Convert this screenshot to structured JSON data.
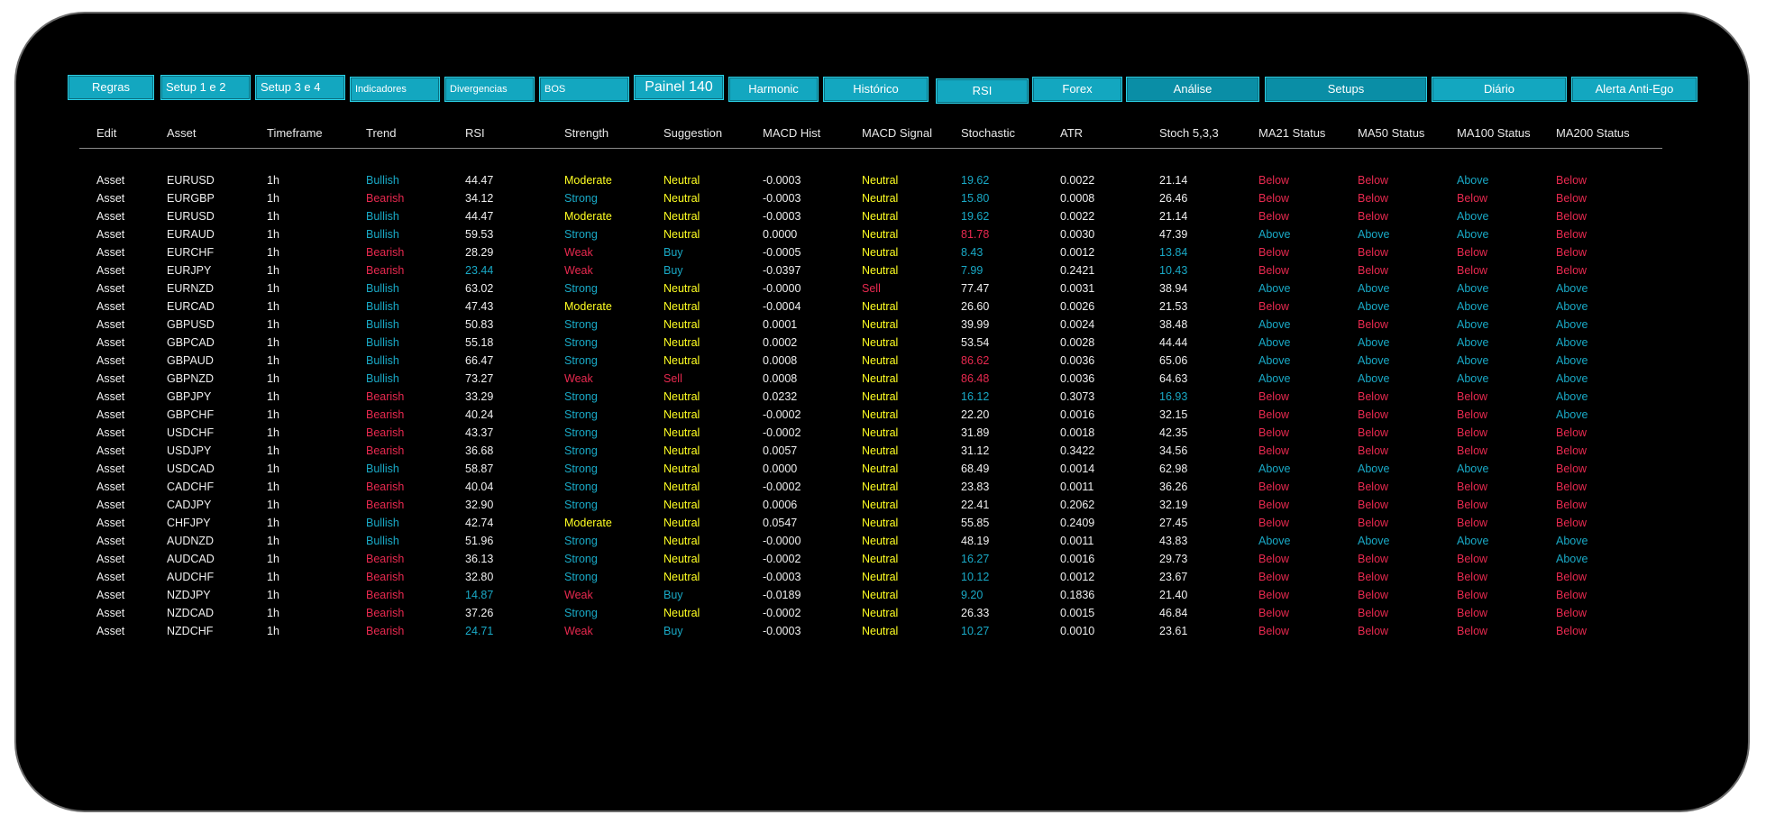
{
  "colors": {
    "cyan": "#19a9c6",
    "red": "#e8294f",
    "yellow": "#ffff22",
    "white": "#f0f0f0",
    "tab": "#13a7c0"
  },
  "tabs": [
    "Regras",
    "Setup 1 e 2",
    "Setup 3 e 4",
    "Indicadores",
    "Divergencias",
    "BOS",
    "Painel 140",
    "Harmonic",
    "Histórico",
    "RSI",
    "Forex",
    "Análise",
    "Setups",
    "Diário",
    "Alerta Anti-Ego"
  ],
  "table": {
    "headers": [
      "Edit",
      "Asset",
      "Timeframe",
      "Trend",
      "RSI",
      "Strength",
      "Suggestion",
      "MACD Hist",
      "MACD Signal",
      "Stochastic",
      "ATR",
      "Stoch 5,3,3",
      "MA21 Status",
      "MA50 Status",
      "MA100 Status",
      "MA200 Status"
    ],
    "rows": [
      [
        "Asset",
        "EURUSD",
        "1h",
        "Bullish",
        "44.47",
        "Moderate",
        "Neutral",
        "-0.0003",
        "Neutral",
        "19.62",
        "0.0022",
        "21.14",
        "Below",
        "Below",
        "Above",
        "Below"
      ],
      [
        "Asset",
        "EURGBP",
        "1h",
        "Bearish",
        "34.12",
        "Strong",
        "Neutral",
        "-0.0003",
        "Neutral",
        "15.80",
        "0.0008",
        "26.46",
        "Below",
        "Below",
        "Below",
        "Below"
      ],
      [
        "Asset",
        "EURUSD",
        "1h",
        "Bullish",
        "44.47",
        "Moderate",
        "Neutral",
        "-0.0003",
        "Neutral",
        "19.62",
        "0.0022",
        "21.14",
        "Below",
        "Below",
        "Above",
        "Below"
      ],
      [
        "Asset",
        "EURAUD",
        "1h",
        "Bullish",
        "59.53",
        "Strong",
        "Neutral",
        "0.0000",
        "Neutral",
        "81.78",
        "0.0030",
        "47.39",
        "Above",
        "Above",
        "Above",
        "Below"
      ],
      [
        "Asset",
        "EURCHF",
        "1h",
        "Bearish",
        "28.29",
        "Weak",
        "Buy",
        "-0.0005",
        "Neutral",
        "8.43",
        "0.0012",
        "13.84",
        "Below",
        "Below",
        "Below",
        "Below"
      ],
      [
        "Asset",
        "EURJPY",
        "1h",
        "Bearish",
        "23.44",
        "Weak",
        "Buy",
        "-0.0397",
        "Neutral",
        "7.99",
        "0.2421",
        "10.43",
        "Below",
        "Below",
        "Below",
        "Below"
      ],
      [
        "Asset",
        "EURNZD",
        "1h",
        "Bullish",
        "63.02",
        "Strong",
        "Neutral",
        "-0.0000",
        "Sell",
        "77.47",
        "0.0031",
        "38.94",
        "Above",
        "Above",
        "Above",
        "Above"
      ],
      [
        "Asset",
        "EURCAD",
        "1h",
        "Bullish",
        "47.43",
        "Moderate",
        "Neutral",
        "-0.0004",
        "Neutral",
        "26.60",
        "0.0026",
        "21.53",
        "Below",
        "Above",
        "Above",
        "Above"
      ],
      [
        "Asset",
        "GBPUSD",
        "1h",
        "Bullish",
        "50.83",
        "Strong",
        "Neutral",
        "0.0001",
        "Neutral",
        "39.99",
        "0.0024",
        "38.48",
        "Above",
        "Below",
        "Above",
        "Above"
      ],
      [
        "Asset",
        "GBPCAD",
        "1h",
        "Bullish",
        "55.18",
        "Strong",
        "Neutral",
        "0.0002",
        "Neutral",
        "53.54",
        "0.0028",
        "44.44",
        "Above",
        "Above",
        "Above",
        "Above"
      ],
      [
        "Asset",
        "GBPAUD",
        "1h",
        "Bullish",
        "66.47",
        "Strong",
        "Neutral",
        "0.0008",
        "Neutral",
        "86.62",
        "0.0036",
        "65.06",
        "Above",
        "Above",
        "Above",
        "Above"
      ],
      [
        "Asset",
        "GBPNZD",
        "1h",
        "Bullish",
        "73.27",
        "Weak",
        "Sell",
        "0.0008",
        "Neutral",
        "86.48",
        "0.0036",
        "64.63",
        "Above",
        "Above",
        "Above",
        "Above"
      ],
      [
        "Asset",
        "GBPJPY",
        "1h",
        "Bearish",
        "33.29",
        "Strong",
        "Neutral",
        "0.0232",
        "Neutral",
        "16.12",
        "0.3073",
        "16.93",
        "Below",
        "Below",
        "Below",
        "Above"
      ],
      [
        "Asset",
        "GBPCHF",
        "1h",
        "Bearish",
        "40.24",
        "Strong",
        "Neutral",
        "-0.0002",
        "Neutral",
        "22.20",
        "0.0016",
        "32.15",
        "Below",
        "Below",
        "Below",
        "Above"
      ],
      [
        "Asset",
        "USDCHF",
        "1h",
        "Bearish",
        "43.37",
        "Strong",
        "Neutral",
        "-0.0002",
        "Neutral",
        "31.89",
        "0.0018",
        "42.35",
        "Below",
        "Below",
        "Below",
        "Below"
      ],
      [
        "Asset",
        "USDJPY",
        "1h",
        "Bearish",
        "36.68",
        "Strong",
        "Neutral",
        "0.0057",
        "Neutral",
        "31.12",
        "0.3422",
        "34.56",
        "Below",
        "Below",
        "Below",
        "Below"
      ],
      [
        "Asset",
        "USDCAD",
        "1h",
        "Bullish",
        "58.87",
        "Strong",
        "Neutral",
        "0.0000",
        "Neutral",
        "68.49",
        "0.0014",
        "62.98",
        "Above",
        "Above",
        "Above",
        "Below"
      ],
      [
        "Asset",
        "CADCHF",
        "1h",
        "Bearish",
        "40.04",
        "Strong",
        "Neutral",
        "-0.0002",
        "Neutral",
        "23.83",
        "0.0011",
        "36.26",
        "Below",
        "Below",
        "Below",
        "Below"
      ],
      [
        "Asset",
        "CADJPY",
        "1h",
        "Bearish",
        "32.90",
        "Strong",
        "Neutral",
        "0.0006",
        "Neutral",
        "22.41",
        "0.2062",
        "32.19",
        "Below",
        "Below",
        "Below",
        "Below"
      ],
      [
        "Asset",
        "CHFJPY",
        "1h",
        "Bullish",
        "42.74",
        "Moderate",
        "Neutral",
        "0.0547",
        "Neutral",
        "55.85",
        "0.2409",
        "27.45",
        "Below",
        "Below",
        "Below",
        "Below"
      ],
      [
        "Asset",
        "AUDNZD",
        "1h",
        "Bullish",
        "51.96",
        "Strong",
        "Neutral",
        "-0.0000",
        "Neutral",
        "48.19",
        "0.0011",
        "43.83",
        "Above",
        "Above",
        "Above",
        "Above"
      ],
      [
        "Asset",
        "AUDCAD",
        "1h",
        "Bearish",
        "36.13",
        "Strong",
        "Neutral",
        "-0.0002",
        "Neutral",
        "16.27",
        "0.0016",
        "29.73",
        "Below",
        "Below",
        "Below",
        "Above"
      ],
      [
        "Asset",
        "AUDCHF",
        "1h",
        "Bearish",
        "32.80",
        "Strong",
        "Neutral",
        "-0.0003",
        "Neutral",
        "10.12",
        "0.0012",
        "23.67",
        "Below",
        "Below",
        "Below",
        "Below"
      ],
      [
        "Asset",
        "NZDJPY",
        "1h",
        "Bearish",
        "14.87",
        "Weak",
        "Buy",
        "-0.0189",
        "Neutral",
        "9.20",
        "0.1836",
        "21.40",
        "Below",
        "Below",
        "Below",
        "Below"
      ],
      [
        "Asset",
        "NZDCAD",
        "1h",
        "Bearish",
        "37.26",
        "Strong",
        "Neutral",
        "-0.0002",
        "Neutral",
        "26.33",
        "0.0015",
        "46.84",
        "Below",
        "Below",
        "Below",
        "Below"
      ],
      [
        "Asset",
        "NZDCHF",
        "1h",
        "Bearish",
        "24.71",
        "Weak",
        "Buy",
        "-0.0003",
        "Neutral",
        "10.27",
        "0.0010",
        "23.61",
        "Below",
        "Below",
        "Below",
        "Below"
      ]
    ]
  }
}
